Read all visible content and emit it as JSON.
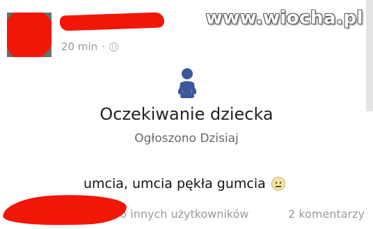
{
  "post": {
    "timestamp": "20 min",
    "separator": "·",
    "privacy_icon": "globe-icon",
    "status_text": "umcia, umcia pękła gumcia",
    "status_emoji": "neutral-face-icon"
  },
  "life_event": {
    "icon": "baby-icon",
    "title": "Oczekiwanie dziecka",
    "subtitle": "Ogłoszono Dzisiaj"
  },
  "footer": {
    "likes_text": "6 innych użytkowników",
    "comments_text": "2 komentarzy"
  },
  "watermark": {
    "text": "www.wiocha.pl"
  },
  "colors": {
    "censor_red": "#f11608",
    "facebook_blue": "#3b5998",
    "muted_text": "#9a9a9a"
  }
}
